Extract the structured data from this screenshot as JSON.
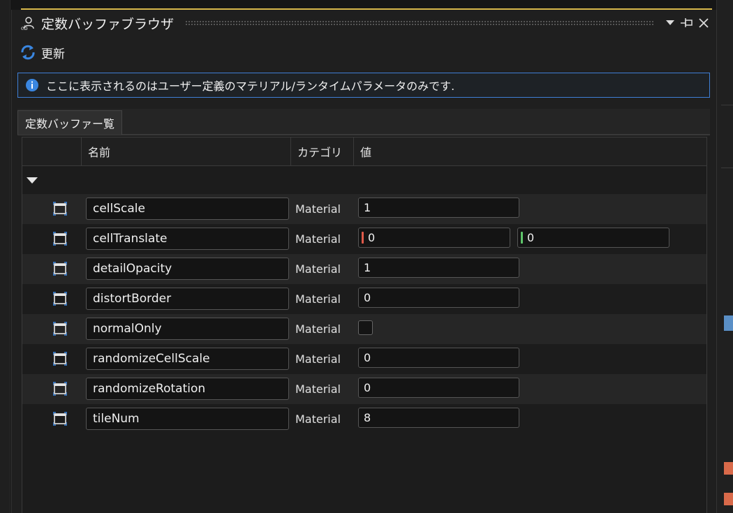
{
  "window": {
    "title": "定数バッファブラウザ",
    "buttons": {
      "dropdown": "▼",
      "pin": "⊣",
      "close": "✕"
    }
  },
  "toolbar": {
    "refresh_label": "更新"
  },
  "info": {
    "message": "ここに表示されるのはユーザー定義のマテリアル/ランタイムパラメータのみです."
  },
  "tabs": [
    {
      "label": "定数バッファー覧"
    }
  ],
  "grid": {
    "columns": {
      "name": "名前",
      "category": "カテゴリ",
      "value": "値"
    },
    "rows": [
      {
        "name": "cellScale",
        "category": "Material",
        "type": "scalar",
        "value": "1"
      },
      {
        "name": "cellTranslate",
        "category": "Material",
        "type": "vector2",
        "values": [
          "0",
          "0"
        ]
      },
      {
        "name": "detailOpacity",
        "category": "Material",
        "type": "scalar",
        "value": "1"
      },
      {
        "name": "distortBorder",
        "category": "Material",
        "type": "scalar",
        "value": "0"
      },
      {
        "name": "normalOnly",
        "category": "Material",
        "type": "bool",
        "checked": false
      },
      {
        "name": "randomizeCellScale",
        "category": "Material",
        "type": "scalar",
        "value": "0"
      },
      {
        "name": "randomizeRotation",
        "category": "Material",
        "type": "scalar",
        "value": "0"
      },
      {
        "name": "tileNum",
        "category": "Material",
        "type": "scalar",
        "value": "8"
      }
    ]
  },
  "colors": {
    "accent_blue": "#3f7fd6",
    "title_accent_line": "#d8b84a",
    "vector_x": "#e05a4a",
    "vector_y": "#5ec46a"
  },
  "icons": {
    "title": "user-icon",
    "refresh": "refresh-icon",
    "info": "info-icon",
    "row": "variable-icon",
    "group": "collapse-triangle-icon"
  }
}
